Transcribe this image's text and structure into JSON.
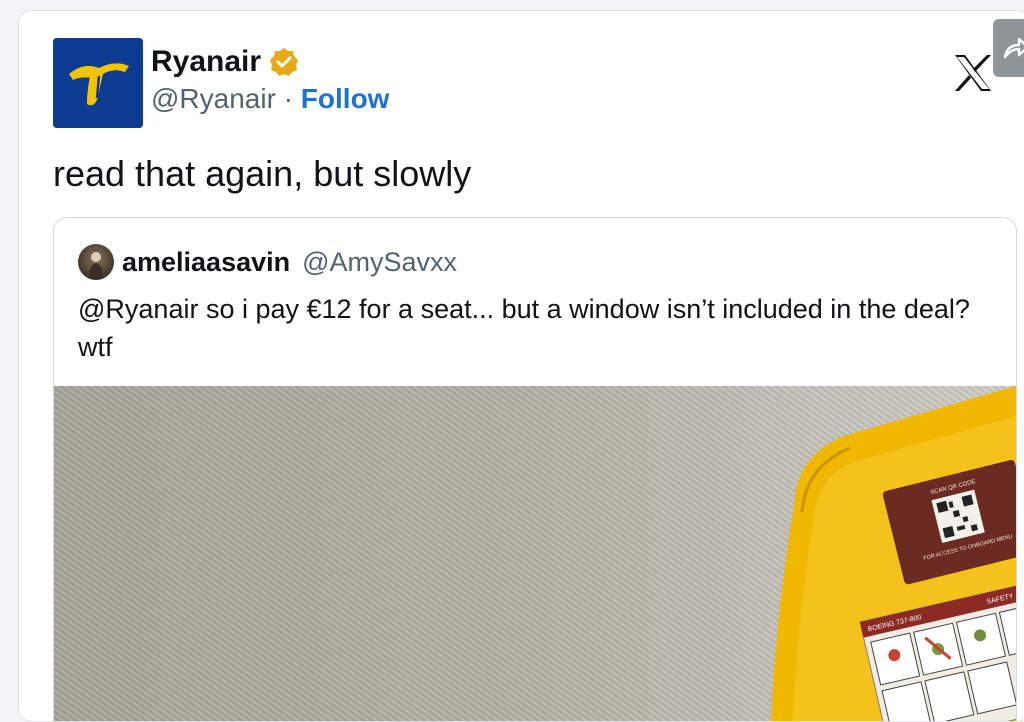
{
  "tweet": {
    "author_name": "Ryanair",
    "author_handle": "@Ryanair",
    "separator": "·",
    "follow_label": "Follow",
    "text": "read that again, but slowly"
  },
  "quoted_tweet": {
    "author_name": "ameliaasavin",
    "author_handle": "@AmySavxx",
    "text": "@Ryanair so i pay €12 for a seat... but a window isn’t included in the deal? wtf"
  },
  "photo": {
    "description_icons": [
      "qr-code-icon",
      "safety-card-icon"
    ],
    "placard_top": "SCAN QR CODE",
    "placard_bottom": "FOR ACCESS TO ONBOARD MENU",
    "card_model": "BOEING 737-800",
    "card_title": "SAFETY"
  },
  "colors": {
    "ryanair_blue": "#0d3b91",
    "ryanair_yellow": "#f2c400",
    "follow_blue": "#1d72d8",
    "verified_gold": "#e8a917",
    "seat_yellow": "#f0b800"
  }
}
